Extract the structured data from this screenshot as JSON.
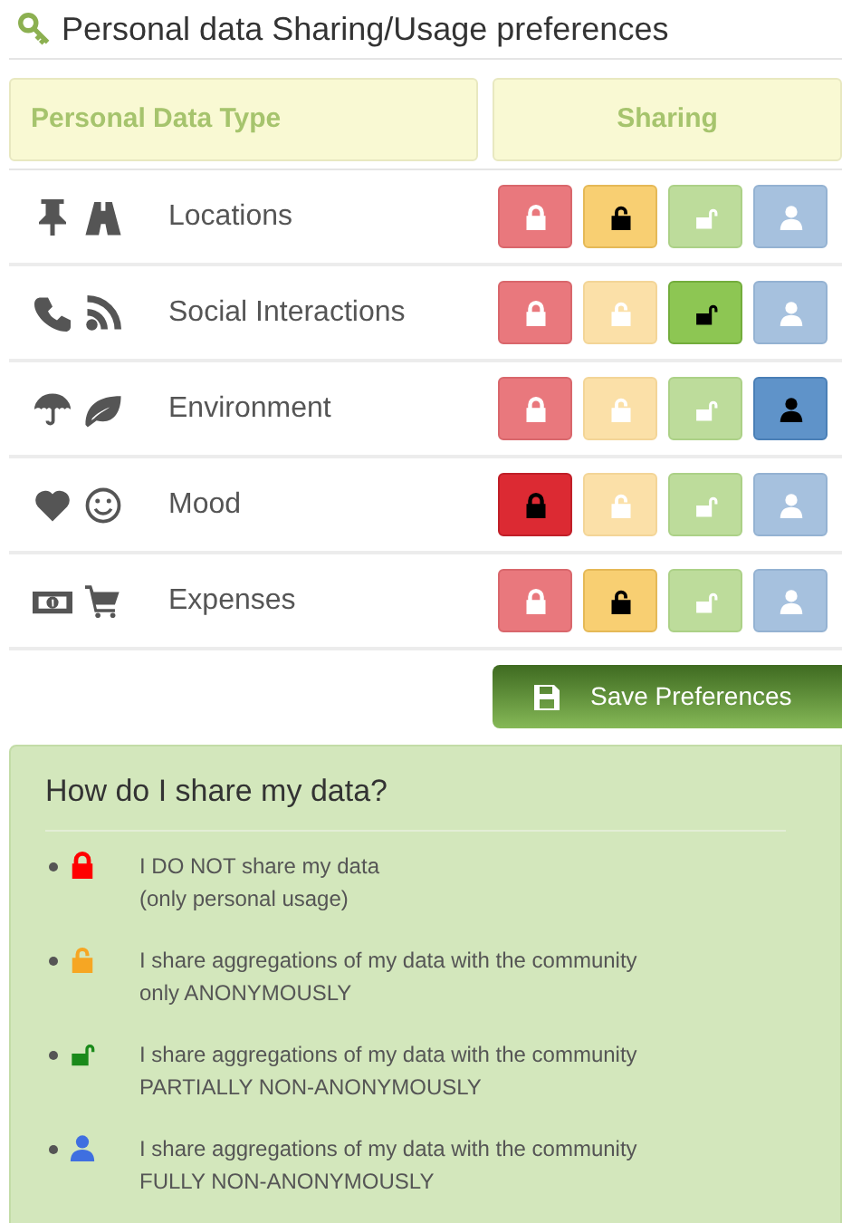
{
  "title": "Personal data Sharing/Usage preferences",
  "table": {
    "columns": [
      "Personal Data Type",
      "Sharing"
    ],
    "rows": [
      {
        "label": "Locations",
        "options": [
          {
            "kind": "private",
            "selected": false
          },
          {
            "kind": "anonymous",
            "selected": true
          },
          {
            "kind": "partial",
            "selected": false
          },
          {
            "kind": "full",
            "selected": false
          }
        ]
      },
      {
        "label": "Social Interactions",
        "options": [
          {
            "kind": "private",
            "selected": false
          },
          {
            "kind": "anonymous",
            "selected": false
          },
          {
            "kind": "partial",
            "selected": true
          },
          {
            "kind": "full",
            "selected": false
          }
        ]
      },
      {
        "label": "Environment",
        "options": [
          {
            "kind": "private",
            "selected": false
          },
          {
            "kind": "anonymous",
            "selected": false
          },
          {
            "kind": "partial",
            "selected": false
          },
          {
            "kind": "full",
            "selected": true
          }
        ]
      },
      {
        "label": "Mood",
        "options": [
          {
            "kind": "private",
            "selected": true
          },
          {
            "kind": "anonymous",
            "selected": false
          },
          {
            "kind": "partial",
            "selected": false
          },
          {
            "kind": "full",
            "selected": false
          }
        ]
      },
      {
        "label": "Expenses",
        "options": [
          {
            "kind": "private",
            "selected": false
          },
          {
            "kind": "anonymous",
            "selected": true
          },
          {
            "kind": "partial",
            "selected": false
          },
          {
            "kind": "full",
            "selected": false
          }
        ]
      }
    ]
  },
  "save_button": "Save Preferences",
  "legend": {
    "title": "How do I share my data?",
    "items": [
      {
        "kind": "private",
        "lines": [
          "I DO NOT share my data",
          "(only personal usage)"
        ]
      },
      {
        "kind": "anonymous",
        "lines": [
          "I share aggregations of my data with the community",
          "only ANONYMOUSLY"
        ]
      },
      {
        "kind": "partial",
        "lines": [
          "I share aggregations of my data with the community",
          "PARTIALLY NON-ANONYMOUSLY"
        ]
      },
      {
        "kind": "full",
        "lines": [
          "I share aggregations of my data with the community",
          "FULLY NON-ANONYMOUSLY"
        ]
      }
    ]
  }
}
